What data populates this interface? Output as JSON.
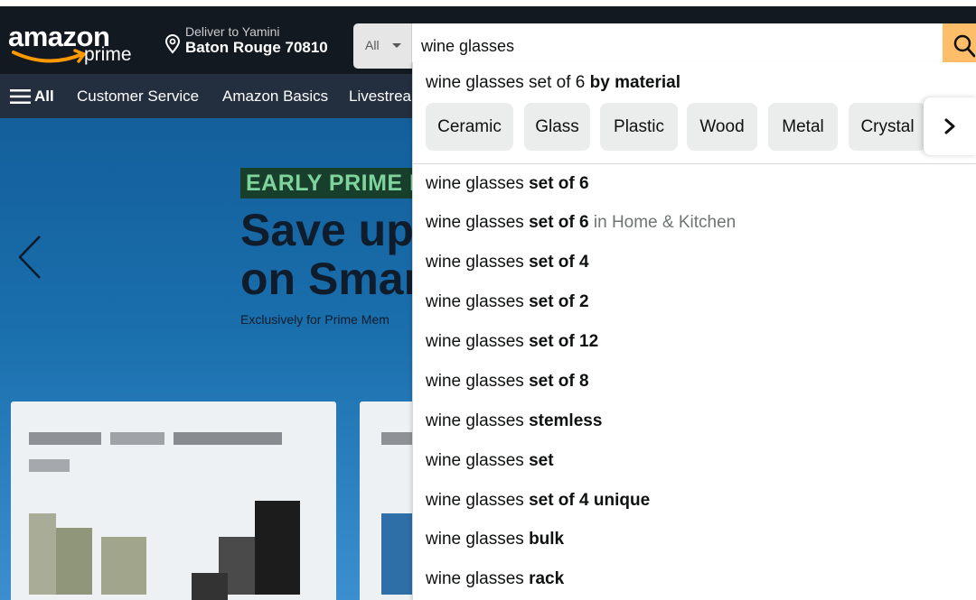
{
  "header": {
    "logo_text": "amazon",
    "logo_prime": "prime",
    "deliver_line1": "Deliver to Yamini",
    "deliver_line2": "Baton Rouge 70810",
    "search_dept": "All",
    "search_value": "wine glasses"
  },
  "nav": {
    "all_label": "All",
    "links": [
      "Customer Service",
      "Amazon Basics",
      "Livestrea"
    ]
  },
  "hero": {
    "badge": "EARLY PRIME DA",
    "headline_1": "Save up",
    "headline_2": "on Smar",
    "subtext": "Exclusively for Prime Mem"
  },
  "suggestions": {
    "material_prefix": "wine glasses set of 6",
    "material_bold": "by material",
    "chips": [
      "Ceramic",
      "Glass",
      "Plastic",
      "Wood",
      "Metal",
      "Crystal"
    ],
    "items": [
      {
        "prefix": "wine glasses",
        "bold": "set of 6",
        "dept": ""
      },
      {
        "prefix": "wine glasses",
        "bold": "set of 6",
        "dept": "in Home & Kitchen"
      },
      {
        "prefix": "wine glasses",
        "bold": "set of 4",
        "dept": ""
      },
      {
        "prefix": "wine glasses",
        "bold": "set of 2",
        "dept": ""
      },
      {
        "prefix": "wine glasses",
        "bold": "set of 12",
        "dept": ""
      },
      {
        "prefix": "wine glasses",
        "bold": "set of 8",
        "dept": ""
      },
      {
        "prefix": "wine glasses",
        "bold": "stemless",
        "dept": ""
      },
      {
        "prefix": "wine glasses",
        "bold": "set",
        "dept": ""
      },
      {
        "prefix": "wine glasses",
        "bold": "set of 4 unique",
        "dept": ""
      },
      {
        "prefix": "wine glasses",
        "bold": "bulk",
        "dept": ""
      },
      {
        "prefix": "wine glasses",
        "bold": "rack",
        "dept": ""
      }
    ]
  },
  "colors": {
    "nav_bg": "#131921",
    "subnav_bg": "#232f3e",
    "search_button": "#febd69",
    "logo_smile": "#ff9900",
    "hero_bg": "#135f9b"
  },
  "icons": [
    "amazon-smile-icon",
    "location-pin-icon",
    "caret-down-icon",
    "search-icon",
    "hamburger-icon",
    "chevron-left-icon",
    "chevron-right-icon"
  ]
}
